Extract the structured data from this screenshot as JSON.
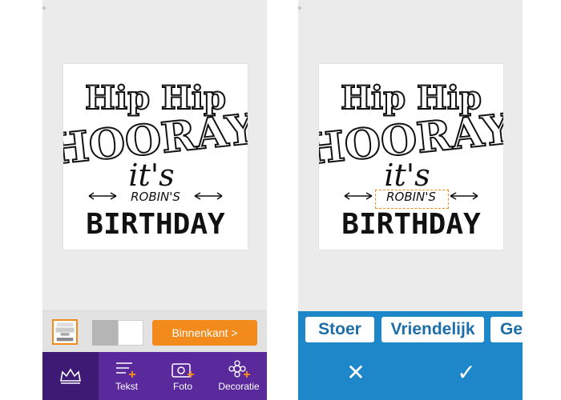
{
  "card": {
    "line1": "Hip Hip",
    "line2": "HOORAY",
    "line3": "it's",
    "line4": "ROBIN'S",
    "line5": "BIRTHDAY"
  },
  "left": {
    "inside_button": "Binnenkant >",
    "nav": [
      {
        "label": "",
        "icon": "crown-icon"
      },
      {
        "label": "Tekst",
        "icon": "text-add-icon"
      },
      {
        "label": "Foto",
        "icon": "photo-add-icon"
      },
      {
        "label": "Decoratie",
        "icon": "decoration-add-icon"
      }
    ]
  },
  "right": {
    "styles": [
      "Stoer",
      "Vriendelijk",
      "Ge"
    ],
    "cancel": "✕",
    "confirm": "✓"
  },
  "colors": {
    "accent": "#f28b1c",
    "nav": "#5a2a9d",
    "blue": "#1d87c9"
  }
}
